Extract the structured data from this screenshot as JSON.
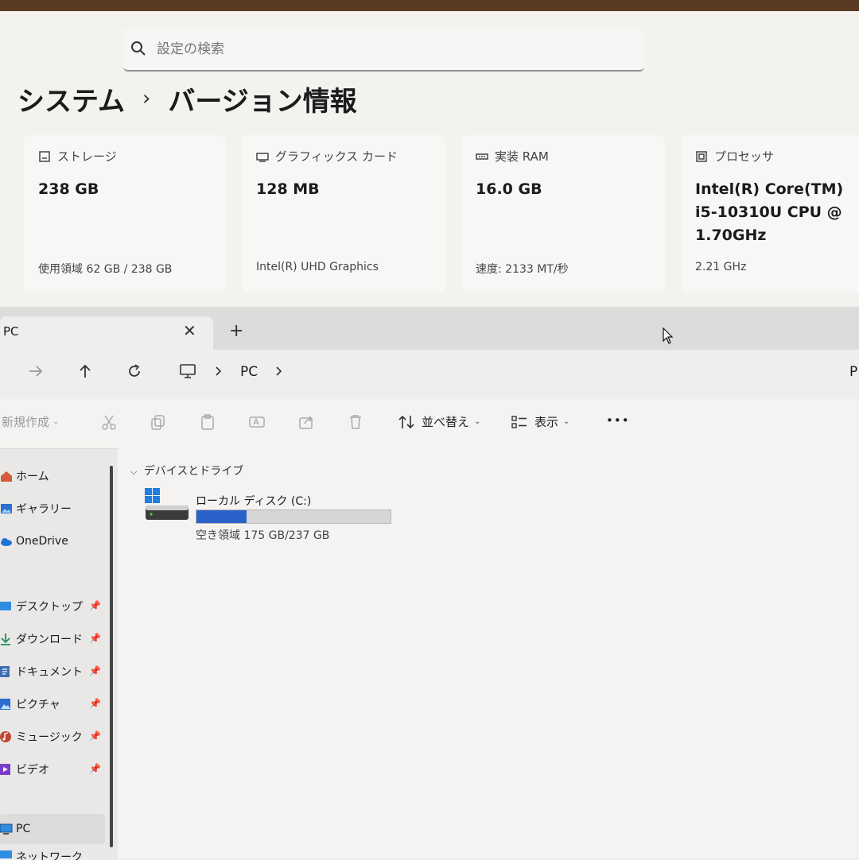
{
  "settings": {
    "search": {
      "placeholder": "設定の検索"
    },
    "breadcrumb": {
      "parent": "システム",
      "separator": "›",
      "current": "バージョン情報"
    },
    "cards": [
      {
        "icon": "storage-icon",
        "label": "ストレージ",
        "value": "238 GB",
        "sub": "使用領域 62 GB / 238 GB"
      },
      {
        "icon": "graphics-card-icon",
        "label": "グラフィックス カード",
        "value": "128 MB",
        "sub": "Intel(R) UHD Graphics"
      },
      {
        "icon": "ram-icon",
        "label": "実装 RAM",
        "value": "16.0 GB",
        "sub": "速度: 2133 MT/秒"
      },
      {
        "icon": "processor-icon",
        "label": "プロセッサ",
        "value_lines": [
          "Intel(R) Core(TM)",
          "i5-10310U CPU @",
          "1.70GHz"
        ],
        "sub": "2.21 GHz"
      }
    ]
  },
  "explorer": {
    "tab": {
      "title": "PC",
      "close": "✕",
      "new": "+"
    },
    "address": {
      "location": "PC",
      "right_text": "P"
    },
    "toolbar": {
      "new_label": "新規作成",
      "sort_label": "並べ替え",
      "view_label": "表示",
      "more": "•••"
    },
    "sidebar": {
      "home": "ホーム",
      "gallery": "ギャラリー",
      "onedrive": "OneDrive",
      "desktop": "デスクトップ",
      "downloads": "ダウンロード",
      "documents": "ドキュメント",
      "pictures": "ピクチャ",
      "music": "ミュージック",
      "videos": "ビデオ",
      "pc": "PC",
      "network": "ネットワーク"
    },
    "content": {
      "group_label": "デバイスとドライブ",
      "drive": {
        "name": "ローカル ディスク (C:)",
        "free_text": "空き領域 175 GB/237 GB",
        "used_fraction": 0.26
      }
    },
    "colors": {
      "drive_bar_fill": "#2a62c9",
      "drive_bar_track": "#d6d6d6"
    }
  }
}
